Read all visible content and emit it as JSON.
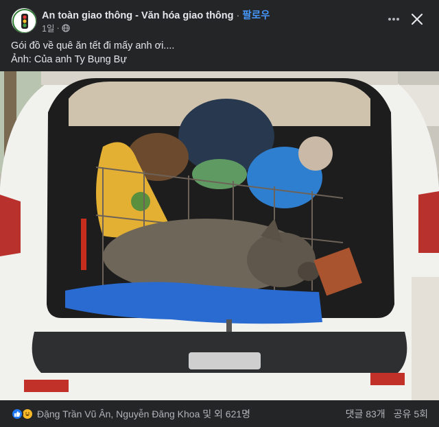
{
  "header": {
    "page_name": "An toàn giao thông - Văn hóa giao thông",
    "separator": "·",
    "follow_label": "팔로우",
    "time": "1일",
    "privacy_icon": "globe-icon",
    "more_icon": "more-horizontal-icon",
    "close_icon": "close-icon"
  },
  "caption": {
    "line1": "Gói đồ về quê ăn tết đi mấy anh ơi....",
    "line2": "Ảnh: Của anh Ty Bụng Bự"
  },
  "footer": {
    "reaction_icons": [
      "like-icon",
      "haha-icon"
    ],
    "reactions_text": "Đặng Trần Vũ Ân, Nguyễn Đăng Khoa 및 외 621명",
    "comments": "댓글 83개",
    "shares": "공유 5회"
  },
  "colors": {
    "background": "#242526",
    "text_primary": "#e4e6eb",
    "text_secondary": "#b0b3b8",
    "follow_link": "#4599ff",
    "like_blue": "#2078f4",
    "haha_yellow": "#f7b928"
  }
}
